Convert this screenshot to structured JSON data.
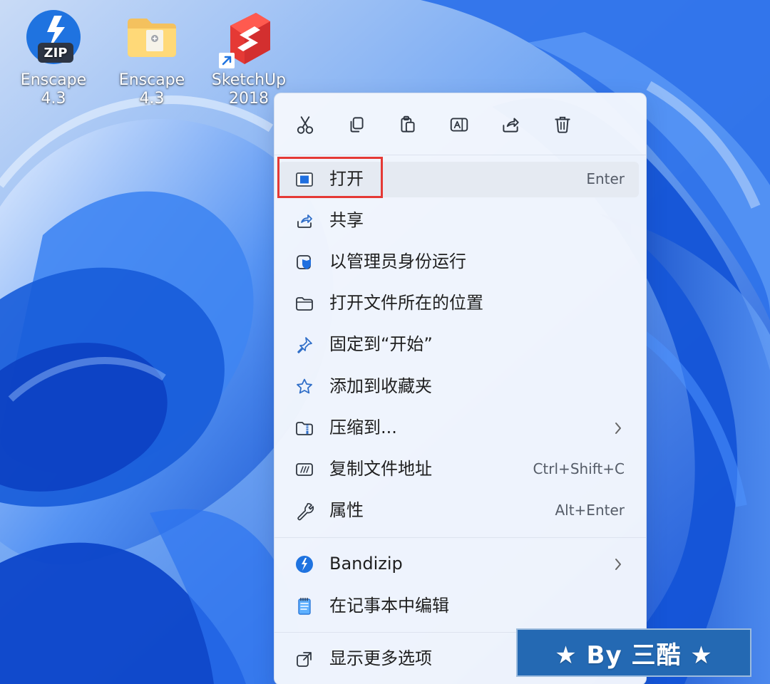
{
  "desktop": {
    "icons": [
      {
        "label": "Enscape 4.3",
        "icon": "zip-archive-icon"
      },
      {
        "label": "Enscape 4.3",
        "icon": "folder-icon"
      },
      {
        "label": "SketchUp\n2018",
        "icon": "sketchup-icon",
        "shortcut_icon": "shortcut-arrow-icon"
      }
    ]
  },
  "context_menu": {
    "toolbar": [
      {
        "name": "cut",
        "icon": "scissors-icon"
      },
      {
        "name": "copy",
        "icon": "copy-icon"
      },
      {
        "name": "paste",
        "icon": "paste-icon"
      },
      {
        "name": "rename",
        "icon": "rename-icon"
      },
      {
        "name": "share",
        "icon": "share-icon"
      },
      {
        "name": "delete",
        "icon": "trash-icon"
      }
    ],
    "items": [
      {
        "label": "打开",
        "shortcut": "Enter",
        "icon": "open-app-icon",
        "highlighted": true
      },
      {
        "label": "共享",
        "icon": "share-icon"
      },
      {
        "label": "以管理员身份运行",
        "icon": "admin-shield-icon"
      },
      {
        "label": "打开文件所在的位置",
        "icon": "folder-outline-icon"
      },
      {
        "label": "固定到“开始”",
        "icon": "pin-icon"
      },
      {
        "label": "添加到收藏夹",
        "icon": "star-icon"
      },
      {
        "label": "压缩到...",
        "icon": "zip-folder-icon",
        "submenu": true
      },
      {
        "label": "复制文件地址",
        "shortcut": "Ctrl+Shift+C",
        "icon": "copy-path-icon"
      },
      {
        "label": "属性",
        "shortcut": "Alt+Enter",
        "icon": "wrench-icon"
      },
      {
        "label": "Bandizip",
        "icon": "bandizip-icon",
        "submenu": true
      },
      {
        "label": "在记事本中编辑",
        "icon": "notepad-icon"
      },
      {
        "label": "显示更多选项",
        "icon": "more-options-icon"
      }
    ]
  },
  "watermark": {
    "text": "★ By 三酷 ★"
  },
  "colors": {
    "highlight_border": "#e53935",
    "menu_background": "#f4f7fd",
    "watermark_background": "#2469b3"
  }
}
